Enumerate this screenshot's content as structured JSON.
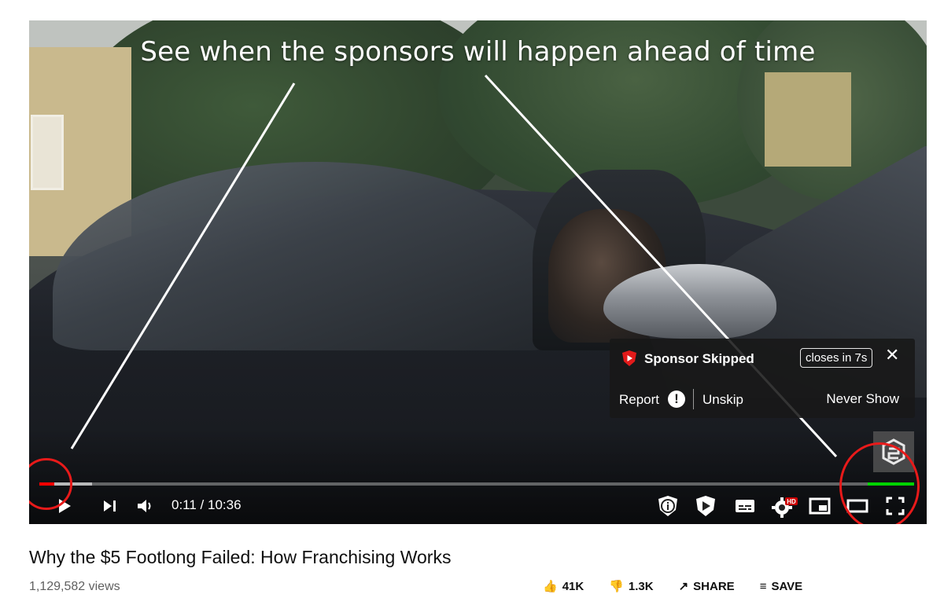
{
  "annotation": {
    "caption": "See when the sponsors will happen ahead of time",
    "line_color": "#ffffff",
    "highlight_color": "#e81a1a"
  },
  "skip_notice": {
    "title": "Sponsor Skipped",
    "timer": "closes in 7s",
    "report_label": "Report",
    "unskip_label": "Unskip",
    "never_show_label": "Never Show",
    "close_icon": "close-icon",
    "info_icon": "exclamation-icon"
  },
  "player": {
    "current_time": "0:11",
    "duration": "10:36",
    "time_display": "0:11 / 10:36",
    "progress_fraction": 0.017,
    "sponsor_segments": [
      {
        "start_fraction": 0.0,
        "end_fraction": 0.012,
        "color": "#00d400"
      },
      {
        "start_fraction": 0.947,
        "end_fraction": 1.0,
        "color": "#00d400"
      }
    ],
    "buttons": {
      "play": "play-icon",
      "next": "next-icon",
      "volume": "volume-icon",
      "sponsor_info": "sponsorblock-info-icon",
      "submit_sponsor": "sponsorblock-submit-icon",
      "subtitles": "subtitles-icon",
      "settings": "settings-gear-icon",
      "settings_badge": "HD",
      "miniplayer": "miniplayer-icon",
      "theater": "theater-mode-icon",
      "fullscreen": "fullscreen-icon"
    },
    "colors": {
      "played": "#ff0000",
      "sponsor": "#00d400"
    }
  },
  "video": {
    "title": "Why the $5 Footlong Failed: How Franchising Works",
    "views": "1,129,582 views",
    "actions": [
      "41K",
      "1.3K",
      "SHARE",
      "SAVE"
    ]
  }
}
